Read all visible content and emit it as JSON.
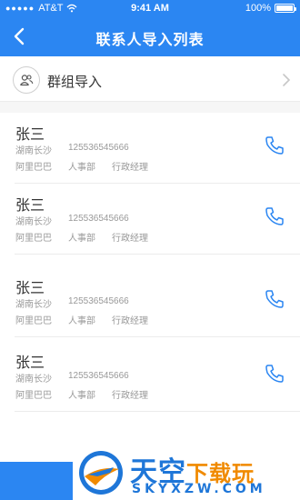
{
  "status_bar": {
    "carrier": "AT&T",
    "time": "9:41 AM",
    "battery": "100%"
  },
  "nav": {
    "title": "联系人导入列表"
  },
  "group_import": {
    "label": "群组导入"
  },
  "contacts": [
    {
      "name": "张三",
      "location": "湖南长沙",
      "phone": "125536545666",
      "company": "阿里巴巴",
      "department": "人事部",
      "title": "行政经理"
    },
    {
      "name": "张三",
      "location": "湖南长沙",
      "phone": "125536545666",
      "company": "阿里巴巴",
      "department": "人事部",
      "title": "行政经理"
    },
    {
      "name": "张三",
      "location": "湖南长沙",
      "phone": "125536545666",
      "company": "阿里巴巴",
      "department": "人事部",
      "title": "行政经理"
    },
    {
      "name": "张三",
      "location": "湖南长沙",
      "phone": "125536545666",
      "company": "阿里巴巴",
      "department": "人事部",
      "title": "行政经理"
    }
  ],
  "watermark": {
    "title_main": "天空",
    "title_highlight": "下载玩",
    "subtitle": "SKYXZW.COM"
  },
  "colors": {
    "accent": "#2b86f2",
    "watermark_blue": "#1e76d8",
    "watermark_orange": "#f08a00"
  }
}
